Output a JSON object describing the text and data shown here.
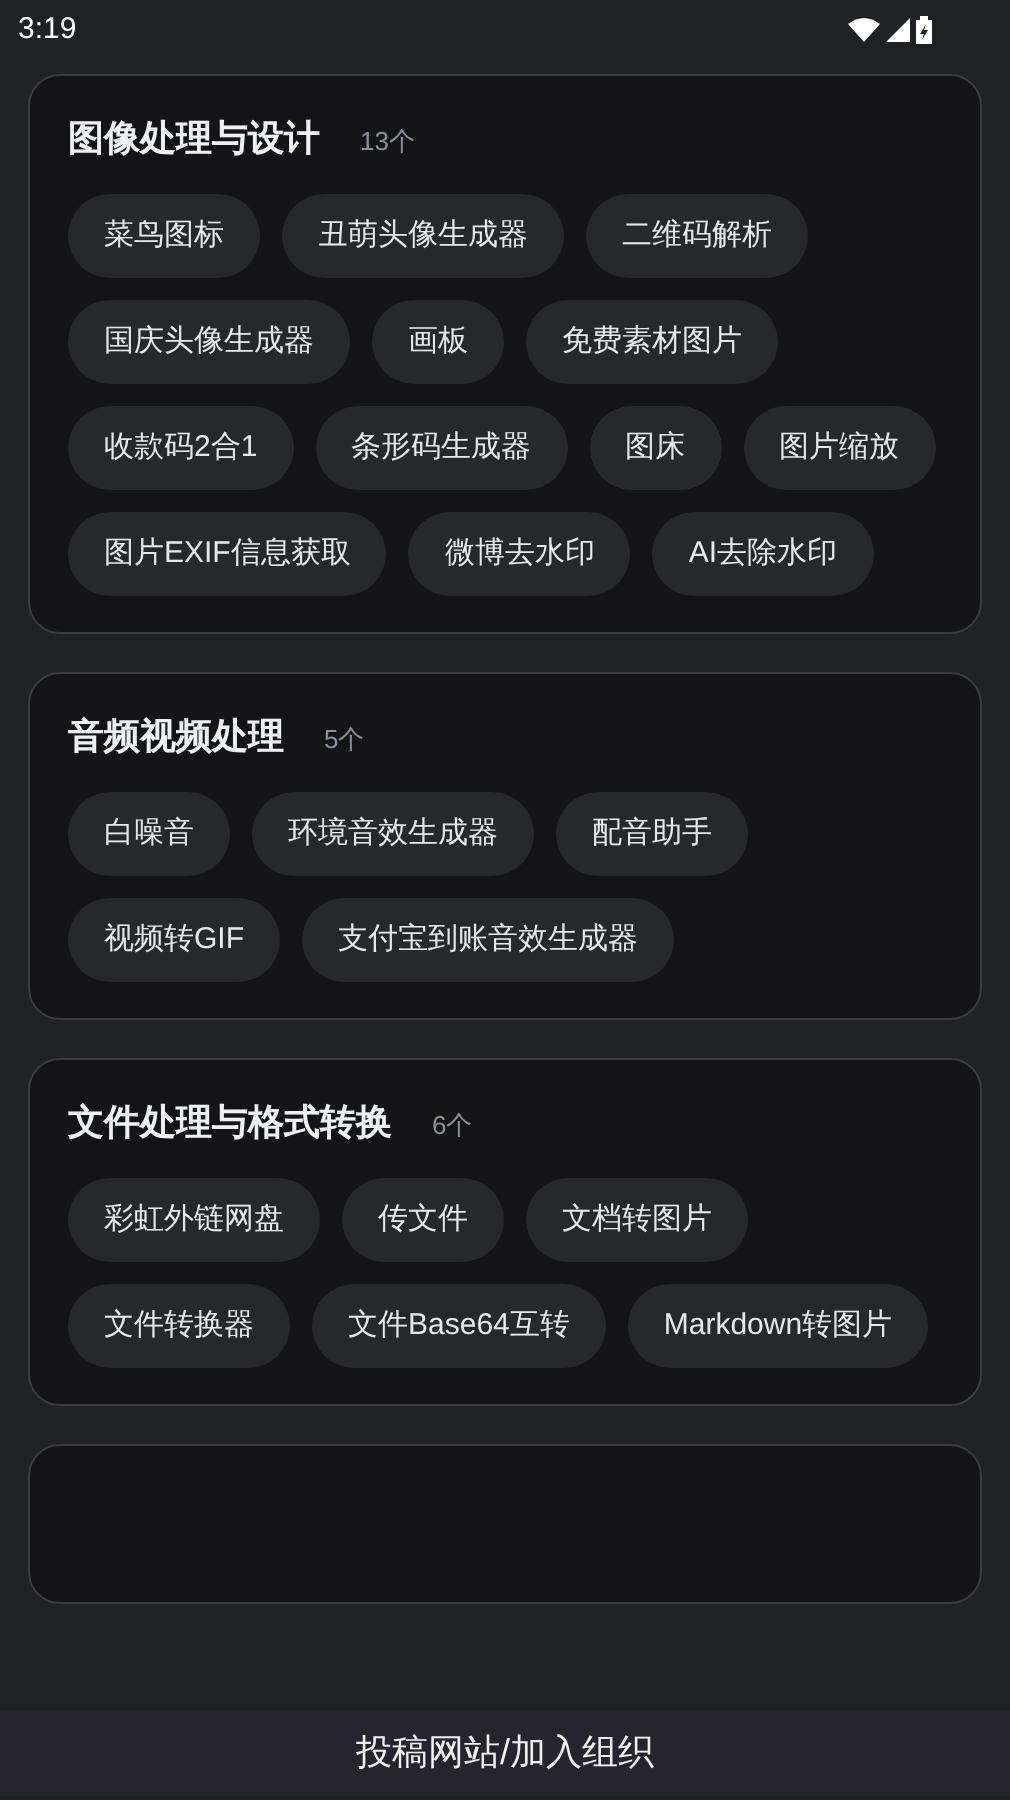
{
  "status_bar": {
    "time": "3:19"
  },
  "sections": [
    {
      "title": "图像处理与设计",
      "count": "13个",
      "tools": [
        "菜鸟图标",
        "丑萌头像生成器",
        "二维码解析",
        "国庆头像生成器",
        "画板",
        "免费素材图片",
        "收款码2合1",
        "条形码生成器",
        "图床",
        "图片缩放",
        "图片EXIF信息获取",
        "微博去水印",
        "AI去除水印"
      ]
    },
    {
      "title": "音频视频处理",
      "count": "5个",
      "tools": [
        "白噪音",
        "环境音效生成器",
        "配音助手",
        "视频转GIF",
        "支付宝到账音效生成器"
      ]
    },
    {
      "title": "文件处理与格式转换",
      "count": "6个",
      "tools": [
        "彩虹外链网盘",
        "传文件",
        "文档转图片",
        "文件转换器",
        "文件Base64互转",
        "Markdown转图片"
      ]
    }
  ],
  "bottom_button": "投稿网站/加入组织"
}
